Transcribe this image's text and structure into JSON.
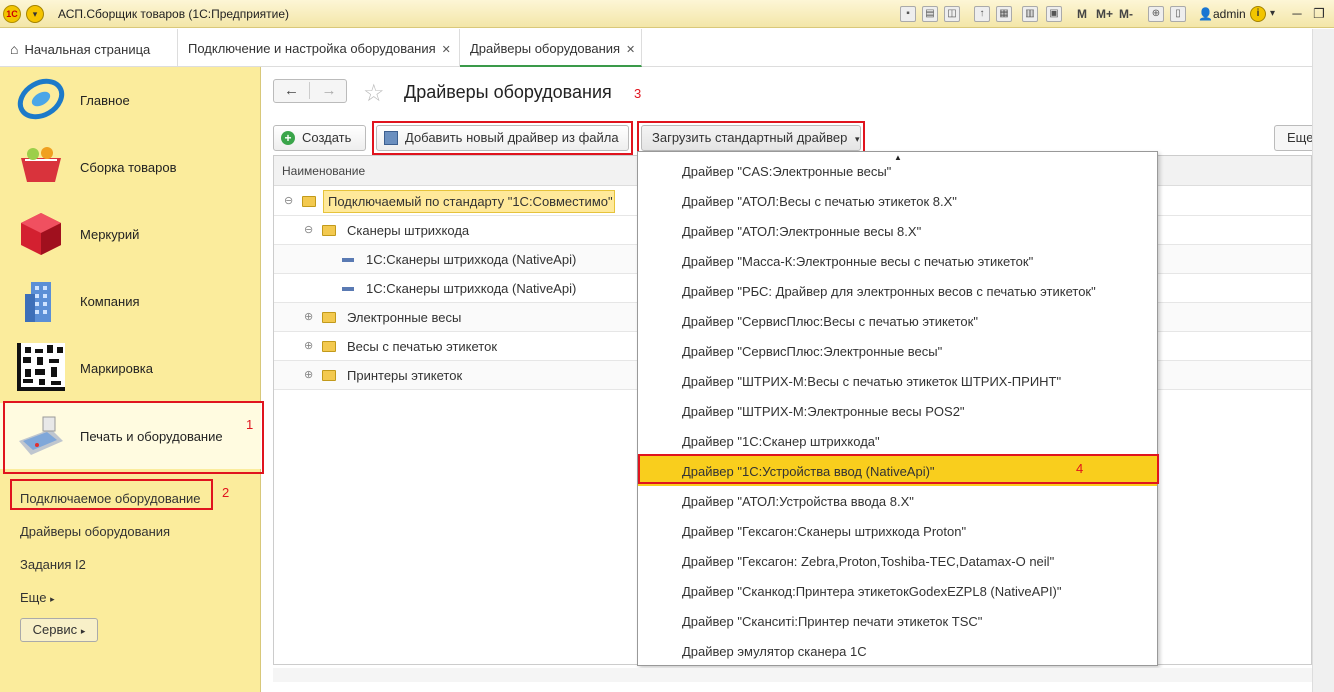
{
  "window": {
    "title": "АСП.Сборщик товаров  (1С:Предприятие)",
    "logo_text": "1С",
    "toolbar_m": "M",
    "toolbar_mplus": "M+",
    "toolbar_mminus": "M-",
    "user": "admin"
  },
  "tabs": [
    {
      "label": "Начальная страница"
    },
    {
      "label": "Подключение и настройка оборудования"
    },
    {
      "label": "Драйверы оборудования"
    }
  ],
  "sidebar": {
    "sections": [
      {
        "label": "Главное"
      },
      {
        "label": "Сборка товаров"
      },
      {
        "label": "Меркурий"
      },
      {
        "label": "Компания"
      },
      {
        "label": "Маркировка"
      },
      {
        "label": "Печать и оборудование"
      }
    ],
    "subitems": [
      {
        "label": "Подключаемое оборудование"
      },
      {
        "label": "Драйверы оборудования"
      },
      {
        "label": "Задания I2"
      },
      {
        "label": "Еще"
      }
    ],
    "servis_label": "Сервис"
  },
  "annotations": {
    "n1": "1",
    "n2": "2",
    "n3": "3",
    "n4": "4"
  },
  "page": {
    "title": "Драйверы оборудования"
  },
  "toolbar": {
    "create_label": "Создать",
    "add_from_file_label": "Добавить новый драйвер из файла",
    "load_standard_label": "Загрузить стандартный драйвер",
    "more_label": "Еще"
  },
  "table": {
    "header": "Наименование",
    "rows": [
      {
        "label": "Подключаемый по стандарту \"1С:Совместимо\""
      },
      {
        "label": "Сканеры штрихкода"
      },
      {
        "label": "1С:Сканеры штрихкода (NativeApi)"
      },
      {
        "label": "1С:Сканеры штрихкода (NativeApi)"
      },
      {
        "label": "Электронные весы"
      },
      {
        "label": "Весы с печатью этикеток"
      },
      {
        "label": "Принтеры этикеток"
      }
    ]
  },
  "dropdown": {
    "items": [
      {
        "label": "Драйвер \"CAS:Электронные весы\""
      },
      {
        "label": "Драйвер \"АТОЛ:Весы с печатью этикеток 8.X\""
      },
      {
        "label": "Драйвер \"АТОЛ:Электронные весы 8.X\""
      },
      {
        "label": "Драйвер \"Масса-К:Электронные весы с печатью этикеток\""
      },
      {
        "label": "Драйвер \"РБС: Драйвер для электронных весов с печатью этикеток\""
      },
      {
        "label": "Драйвер \"СервисПлюс:Весы с печатью этикеток\""
      },
      {
        "label": "Драйвер \"СервисПлюс:Электронные весы\""
      },
      {
        "label": "Драйвер \"ШТРИХ-М:Весы с печатью этикеток ШТРИХ-ПРИНТ\""
      },
      {
        "label": "Драйвер \"ШТРИХ-М:Электронные весы POS2\""
      },
      {
        "label": "Драйвер \"1С:Сканер штрихкода\""
      },
      {
        "label": "Драйвер \"1С:Устройства ввод (NativeApi)\""
      },
      {
        "label": "Драйвер \"АТОЛ:Устройства ввода 8.X\""
      },
      {
        "label": "Драйвер \"Гексагон:Сканеры штрихкода Proton\""
      },
      {
        "label": "Драйвер \"Гексагон: Zebra,Proton,Toshiba-TEC,Datamax-O neil\""
      },
      {
        "label": "Драйвер \"Сканкод:Принтера этикетокGodexEZPL8 (NativeAPI)\""
      },
      {
        "label": "Драйвер \"Сканситi:Принтер печати этикеток TSC\""
      },
      {
        "label": "Драйвер эмулятор сканера 1С"
      }
    ]
  },
  "colors": {
    "accent_green": "#3a9a4a",
    "highlight_red": "#e0141e",
    "selected_yellow": "#f9ce1d",
    "sidebar_bg": "#fbec9c"
  }
}
